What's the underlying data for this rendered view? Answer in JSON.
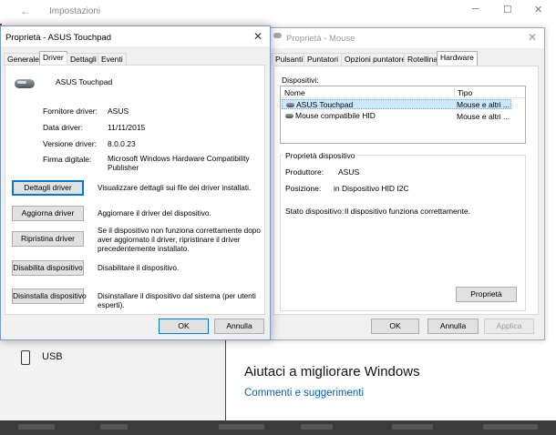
{
  "settings": {
    "title": "Impostazioni",
    "usb_label": "USB",
    "help_title": "Aiutaci a migliorare Windows",
    "help_link": "Commenti e suggerimenti"
  },
  "touchpad_dialog": {
    "title": "Proprietà - ASUS Touchpad",
    "tabs": [
      "Generale",
      "Driver",
      "Dettagli",
      "Eventi"
    ],
    "active_tab": "Driver",
    "device_name": "ASUS Touchpad",
    "info": [
      {
        "label": "Fornitore driver:",
        "value": "ASUS"
      },
      {
        "label": "Data driver:",
        "value": "11/11/2015"
      },
      {
        "label": "Versione driver:",
        "value": "8.0.0.23"
      },
      {
        "label": "Firma digitale:",
        "value": "Microsoft Windows Hardware Compatibility Publisher"
      }
    ],
    "actions": [
      {
        "button": "Dettagli driver",
        "description": "Visualizzare dettagli sui file dei driver installati."
      },
      {
        "button": "Aggiorna driver",
        "description": "Aggiornare il driver del dispositivo."
      },
      {
        "button": "Ripristina driver",
        "description": "Se il dispositivo non funziona correttamente dopo aver aggiornato il driver, ripristinare il driver precedentemente installato."
      },
      {
        "button": "Disabilita dispositivo",
        "description": "Disabilitare il dispositivo."
      },
      {
        "button": "Disinstalla dispositivo",
        "description": "Disinstallare il dispositivo dal sistema (per utenti esperti)."
      }
    ],
    "ok_label": "OK",
    "cancel_label": "Annulla"
  },
  "mouse_dialog": {
    "title": "Proprietà - Mouse",
    "tabs": [
      "Pulsanti",
      "Puntatori",
      "Opzioni puntatore",
      "Rotellina",
      "Hardware"
    ],
    "active_tab": "Hardware",
    "devices_label": "Dispositivi:",
    "columns": [
      "Nome",
      "Tipo"
    ],
    "devices": [
      {
        "name": "ASUS Touchpad",
        "type": "Mouse e altri ..."
      },
      {
        "name": "Mouse compatibile HID",
        "type": "Mouse e altri ..."
      }
    ],
    "props_group_label": "Proprietà dispositivo",
    "props": [
      {
        "label": "Produttore:",
        "value": "ASUS"
      },
      {
        "label": "Posizione:",
        "value": "in Dispositivo HID I2C"
      },
      {
        "label": "Stato dispositivo:",
        "value": "Il dispositivo funziona correttamente."
      }
    ],
    "properties_button": "Proprietà",
    "ok_label": "OK",
    "cancel_label": "Annulla",
    "apply_label": "Applica"
  },
  "colors": {
    "accent": "#0078d7",
    "link": "#0063b1",
    "selection": "#cce8ff"
  }
}
